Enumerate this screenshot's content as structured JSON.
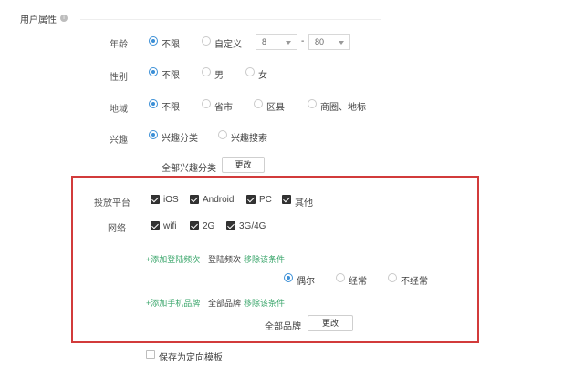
{
  "section": {
    "title": "用户属性",
    "info_icon": "i"
  },
  "age": {
    "label": "年龄",
    "options": [
      "不限",
      "自定义"
    ],
    "selected": "不限",
    "min_value": "8",
    "dash": "-",
    "max_value": "80"
  },
  "gender": {
    "label": "性别",
    "options": [
      "不限",
      "男",
      "女"
    ],
    "selected": "不限"
  },
  "region": {
    "label": "地域",
    "options": [
      "不限",
      "省市",
      "区县",
      "商圈、地标"
    ],
    "selected": "不限"
  },
  "interest": {
    "label": "兴趣",
    "options": [
      "兴趣分类",
      "兴趣搜索"
    ],
    "selected": "兴趣分类",
    "summary": "全部兴趣分类",
    "change_button": "更改"
  },
  "platform": {
    "label": "投放平台",
    "options": [
      {
        "label": "iOS",
        "checked": true
      },
      {
        "label": "Android",
        "checked": true
      },
      {
        "label": "PC",
        "checked": true
      },
      {
        "label": "其他",
        "checked": true
      }
    ]
  },
  "network": {
    "label": "网络",
    "options": [
      {
        "label": "wifi",
        "checked": true
      },
      {
        "label": "2G",
        "checked": true
      },
      {
        "label": "3G/4G",
        "checked": true
      }
    ]
  },
  "login_freq": {
    "add_link": "+添加登陆频次",
    "title": "登陆频次",
    "remove_link": "移除该条件",
    "options": [
      "偶尔",
      "经常",
      "不经常"
    ],
    "selected": "偶尔"
  },
  "phone_brand": {
    "add_link": "+添加手机品牌",
    "title": "全部品牌",
    "remove_link": "移除该条件",
    "summary": "全部品牌",
    "change_button": "更改"
  },
  "save_template": {
    "label": "保存为定向模板",
    "checked": false
  },
  "colors": {
    "accent": "#3b8fd6",
    "link": "#3aa66b",
    "highlight_border": "#d23b3b"
  }
}
